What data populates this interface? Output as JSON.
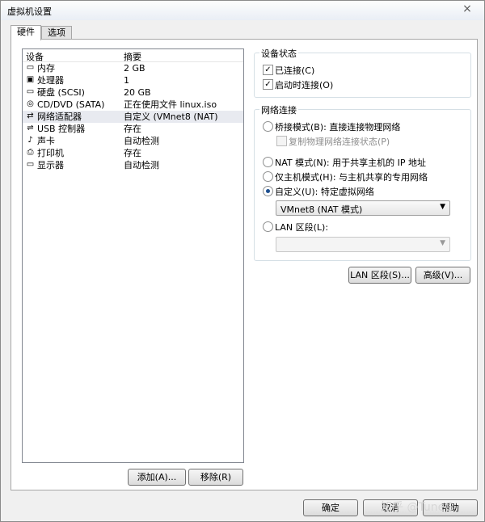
{
  "window": {
    "title": "虚拟机设置",
    "close": "×"
  },
  "tabs": [
    {
      "label": "硬件"
    },
    {
      "label": "选项"
    }
  ],
  "devices": {
    "header": {
      "device": "设备",
      "summary": "摘要"
    },
    "rows": [
      {
        "icon": "memory-icon",
        "glyph": "▭",
        "name": "内存",
        "summary": "2 GB"
      },
      {
        "icon": "processor-icon",
        "glyph": "▣",
        "name": "处理器",
        "summary": "1"
      },
      {
        "icon": "hard-disk-icon",
        "glyph": "▭",
        "name": "硬盘 (SCSI)",
        "summary": "20 GB"
      },
      {
        "icon": "cd-dvd-icon",
        "glyph": "◎",
        "name": "CD/DVD (SATA)",
        "summary": "正在使用文件 linux.iso"
      },
      {
        "icon": "network-adapter-icon",
        "glyph": "⇄",
        "name": "网络适配器",
        "summary": "自定义 (VMnet8 (NAT)"
      },
      {
        "icon": "usb-controller-icon",
        "glyph": "⇌",
        "name": "USB 控制器",
        "summary": "存在"
      },
      {
        "icon": "sound-card-icon",
        "glyph": "♪",
        "name": "声卡",
        "summary": "自动检测"
      },
      {
        "icon": "printer-icon",
        "glyph": "⎙",
        "name": "打印机",
        "summary": "存在"
      },
      {
        "icon": "display-icon",
        "glyph": "▭",
        "name": "显示器",
        "summary": "自动检测"
      }
    ],
    "selected_index": 4
  },
  "buttons": {
    "add": "添加(A)...",
    "remove": "移除(R)",
    "lan_segments": "LAN 区段(S)...",
    "advanced": "高级(V)...",
    "ok": "确定",
    "cancel": "取消",
    "help": "帮助"
  },
  "device_status": {
    "title": "设备状态",
    "connected": {
      "label": "已连接(C)",
      "checked": true
    },
    "connect_on_power": {
      "label": "启动时连接(O)",
      "checked": true
    }
  },
  "network": {
    "title": "网络连接",
    "bridged": {
      "label": "桥接模式(B): 直接连接物理网络",
      "checked": false
    },
    "replicate": {
      "label": "复制物理网络连接状态(P)",
      "checked": false,
      "disabled": true
    },
    "nat": {
      "label": "NAT 模式(N): 用于共享主机的 IP 地址",
      "checked": false
    },
    "host_only": {
      "label": "仅主机模式(H): 与主机共享的专用网络",
      "checked": false
    },
    "custom": {
      "label": "自定义(U): 特定虚拟网络",
      "checked": true
    },
    "custom_select": "VMnet8 (NAT 模式)",
    "lan_segment": {
      "label": "LAN 区段(L):",
      "checked": false
    },
    "lan_select": ""
  },
  "watermark": "知乎 @TuneG"
}
